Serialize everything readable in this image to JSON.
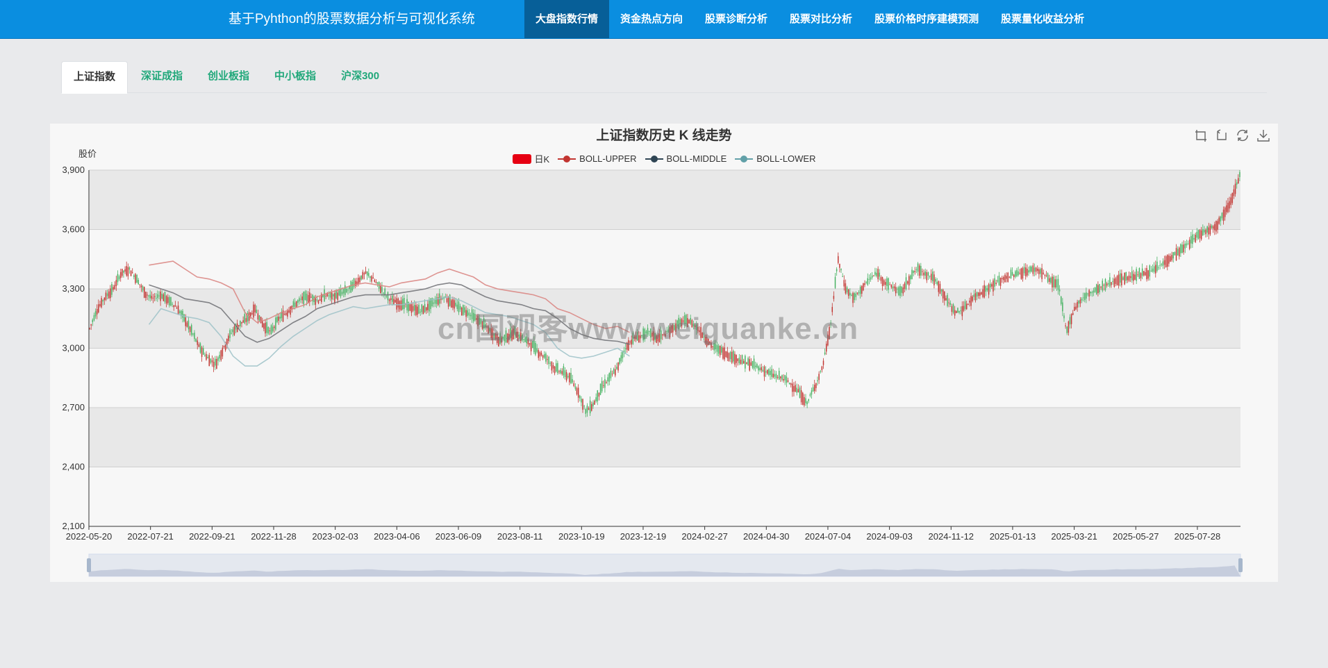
{
  "app": {
    "title": "基于Pyhthon的股票数据分析与可视化系统",
    "nav": [
      {
        "label": "大盘指数行情",
        "active": true
      },
      {
        "label": "资金热点方向",
        "active": false
      },
      {
        "label": "股票诊断分析",
        "active": false
      },
      {
        "label": "股票对比分析",
        "active": false
      },
      {
        "label": "股票价格时序建模预测",
        "active": false
      },
      {
        "label": "股票量化收益分析",
        "active": false
      }
    ]
  },
  "tabs": [
    {
      "label": "上证指数",
      "active": true
    },
    {
      "label": "深证成指",
      "active": false
    },
    {
      "label": "创业板指",
      "active": false
    },
    {
      "label": "中小板指",
      "active": false
    },
    {
      "label": "沪深300",
      "active": false
    }
  ],
  "watermark": "cn国观客www.weiguanke.cn",
  "toolbox": {
    "icons": [
      "zoom-icon",
      "zoom-reset-icon",
      "restore-icon",
      "download-icon"
    ]
  },
  "colors": {
    "up": "#c23531",
    "down": "#47b262",
    "boll_upper": "#d9837f",
    "boll_middle": "#6e7074",
    "boll_lower": "#9ec2c8",
    "band": "#e8e8e8"
  },
  "chart_data": {
    "type": "candlestick",
    "title": "上证指数历史 K 线走势",
    "ylabel": "股价",
    "ylim": [
      2100,
      3900
    ],
    "y_ticks": [
      "3,900",
      "3,600",
      "3,300",
      "3,000",
      "2,700",
      "2,400",
      "2,100"
    ],
    "x_ticks": [
      "2022-05-20",
      "2022-07-21",
      "2022-09-21",
      "2022-11-28",
      "2023-02-03",
      "2023-04-06",
      "2023-06-09",
      "2023-08-11",
      "2023-10-19",
      "2023-12-19",
      "2024-02-27",
      "2024-04-30",
      "2024-07-04",
      "2024-09-03",
      "2024-11-12",
      "2025-01-13",
      "2025-03-21",
      "2025-05-27",
      "2025-07-28"
    ],
    "legend": [
      "日K",
      "BOLL-UPPER",
      "BOLL-MIDDLE",
      "BOLL-LOWER"
    ],
    "close": [
      3100,
      3200,
      3260,
      3300,
      3380,
      3400,
      3350,
      3280,
      3250,
      3270,
      3240,
      3210,
      3150,
      3080,
      3000,
      2950,
      2920,
      3000,
      3080,
      3120,
      3150,
      3200,
      3120,
      3080,
      3150,
      3180,
      3220,
      3250,
      3260,
      3240,
      3270,
      3260,
      3280,
      3300,
      3340,
      3380,
      3350,
      3300,
      3250,
      3230,
      3220,
      3200,
      3190,
      3210,
      3240,
      3260,
      3230,
      3200,
      3180,
      3150,
      3120,
      3080,
      3040,
      3060,
      3080,
      3050,
      3020,
      2980,
      2950,
      2900,
      2880,
      2850,
      2780,
      2680,
      2720,
      2800,
      2850,
      2900,
      3000,
      3050,
      3060,
      3080,
      3050,
      3070,
      3100,
      3130,
      3140,
      3110,
      3060,
      3010,
      2990,
      2970,
      2950,
      2930,
      2920,
      2900,
      2880,
      2860,
      2850,
      2820,
      2780,
      2720,
      2800,
      2900,
      3100,
      3450,
      3300,
      3250,
      3300,
      3350,
      3380,
      3330,
      3310,
      3280,
      3350,
      3400,
      3380,
      3360,
      3300,
      3230,
      3180,
      3200,
      3250,
      3280,
      3300,
      3330,
      3350,
      3370,
      3380,
      3390,
      3400,
      3380,
      3340,
      3320,
      3080,
      3200,
      3250,
      3280,
      3300,
      3320,
      3340,
      3350,
      3360,
      3370,
      3380,
      3390,
      3420,
      3450,
      3480,
      3510,
      3550,
      3580,
      3600,
      3620,
      3680,
      3760,
      3870
    ],
    "boll_upper": [
      null,
      null,
      null,
      null,
      null,
      3420,
      3430,
      3440,
      3400,
      3360,
      3350,
      3330,
      3300,
      3180,
      3130,
      3150,
      3180,
      3200,
      3220,
      3260,
      3280,
      3300,
      3320,
      3330,
      3320,
      3310,
      3330,
      3340,
      3350,
      3380,
      3400,
      3380,
      3360,
      3320,
      3300,
      3290,
      3280,
      3270,
      3250,
      3200,
      3180,
      3150,
      3120,
      3100,
      3110,
      3080,
      null
    ],
    "boll_middle": [
      null,
      null,
      null,
      null,
      null,
      3320,
      3300,
      3280,
      3250,
      3240,
      3230,
      3200,
      3130,
      3060,
      3030,
      3050,
      3090,
      3130,
      3160,
      3200,
      3220,
      3240,
      3260,
      3270,
      3270,
      3270,
      3280,
      3290,
      3300,
      3320,
      3330,
      3320,
      3290,
      3260,
      3240,
      3230,
      3220,
      3200,
      3190,
      3150,
      3100,
      3070,
      3050,
      3040,
      3035,
      3020,
      null
    ],
    "boll_lower": [
      null,
      null,
      null,
      null,
      null,
      3120,
      3200,
      3180,
      3160,
      3150,
      3130,
      3060,
      2960,
      2910,
      2910,
      2950,
      3010,
      3060,
      3100,
      3140,
      3170,
      3190,
      3210,
      3200,
      3210,
      3220,
      3220,
      3230,
      3240,
      3250,
      3260,
      3240,
      3210,
      3180,
      3170,
      3160,
      3140,
      3120,
      3080,
      3000,
      2960,
      2950,
      2960,
      2980,
      3000,
      2960,
      null
    ]
  }
}
